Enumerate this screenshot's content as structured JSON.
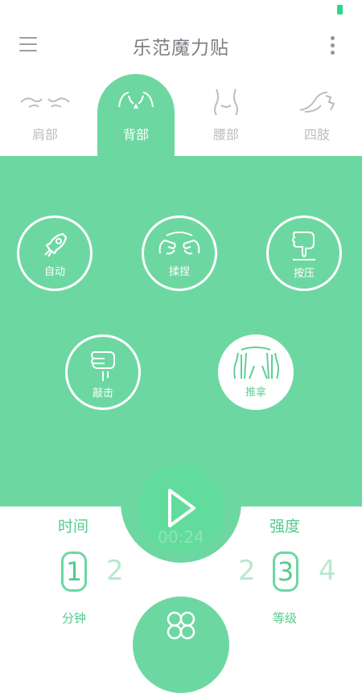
{
  "header": {
    "title": "乐范魔力贴"
  },
  "tabs": [
    {
      "label": "肩部",
      "icon": "shoulder-icon"
    },
    {
      "label": "背部",
      "icon": "back-icon",
      "active": true
    },
    {
      "label": "腰部",
      "icon": "waist-icon"
    },
    {
      "label": "四肢",
      "icon": "limbs-icon"
    }
  ],
  "modes": [
    {
      "label": "自动",
      "icon": "rocket-icon"
    },
    {
      "label": "揉捏",
      "icon": "knead-hands-icon"
    },
    {
      "label": "按压",
      "icon": "press-hand-icon"
    },
    {
      "label": "敲击",
      "icon": "fist-knock-icon"
    },
    {
      "label": "推拿",
      "icon": "push-hands-icon",
      "selected": true
    }
  ],
  "player": {
    "timer": "00:24",
    "icon": "play-icon"
  },
  "time": {
    "title": "时间",
    "selected": "1",
    "next": "2",
    "unit": "分钟"
  },
  "intensity": {
    "title": "强度",
    "prev": "2",
    "selected": "3",
    "next": "4",
    "unit": "等级"
  },
  "colors": {
    "accent": "#6dd7a2",
    "play": "#62dc9c"
  }
}
